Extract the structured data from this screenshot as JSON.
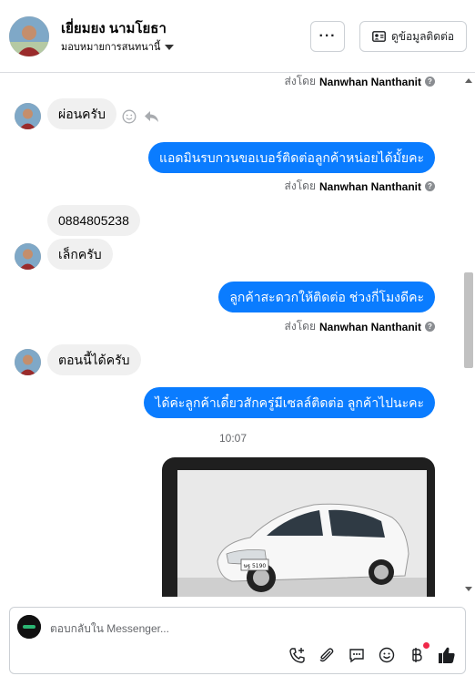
{
  "header": {
    "contact_name": "เยี่ยมยง นามโยธา",
    "assign_label": "มอบหมายการสนทนานี้",
    "more_label": "···",
    "contact_info_label": "ดูข้อมูลติดต่อ"
  },
  "thread": {
    "sent_by_prefix": "ส่งโดย",
    "agent_name": "Nanwhan Nanthanit",
    "help_mark": "?",
    "messages": [
      {
        "text": "ผ่อนครับ"
      },
      {
        "text": "แอดมินรบกวนขอเบอร์ติดต่อลูกค้าหน่อยได้มั้ยคะ"
      },
      {
        "text": "0884805238"
      },
      {
        "text": "เล็กครับ"
      },
      {
        "text": "ลูกค้าสะดวกให้ติดต่อ ช่วงกี่โมงดีคะ"
      },
      {
        "text": "ตอนนี้ได้ครับ"
      },
      {
        "text": "ได้ค่ะลูกค้าเดี๋ยวสักครู่มีเซลล์ติดต่อ ลูกค้าไปนะคะ"
      }
    ],
    "timestamp": "10:07",
    "photo_plate": "ษฐ 5190"
  },
  "composer": {
    "placeholder": "ตอบกลับใน Messenger..."
  },
  "colors": {
    "outgoing_bubble": "#0a7cff",
    "incoming_bubble": "#f0f0f0",
    "notification_dot": "#f02849"
  },
  "icons": [
    "more-icon",
    "contact-card-icon",
    "emoji-icon",
    "reply-icon",
    "help-icon",
    "add-call-icon",
    "attach-icon",
    "saved-reply-icon",
    "smiley-icon",
    "baht-payment-icon",
    "like-icon"
  ]
}
